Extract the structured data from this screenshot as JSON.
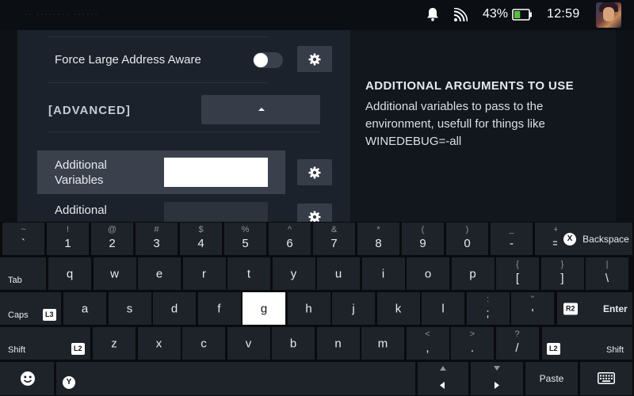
{
  "status": {
    "faint_title": "·· ········ ······",
    "battery_percent": "43%",
    "battery_level": 0.43,
    "time": "12:59",
    "icons": [
      "bell-icon",
      "cast-icon",
      "battery-icon",
      "avatar"
    ]
  },
  "settings": {
    "force_large_address_aware": "Force Large Address Aware",
    "force_large_address_aware_on": false,
    "advanced_header": "[ADVANCED]",
    "additional_variables": "Additional Variables",
    "additional_variables_value": "",
    "additional_arguments": "Additional",
    "gear_icon": "gear-icon"
  },
  "help": {
    "title": "ADDITIONAL ARGUMENTS TO USE",
    "body": "Additional variables to pass to the environment, usefull for things like WINEDEBUG=-all"
  },
  "keyboard": {
    "row1": [
      {
        "top": "~",
        "main": "`"
      },
      {
        "top": "!",
        "main": "1"
      },
      {
        "top": "@",
        "main": "2"
      },
      {
        "top": "#",
        "main": "3"
      },
      {
        "top": "$",
        "main": "4"
      },
      {
        "top": "%",
        "main": "5"
      },
      {
        "top": "^",
        "main": "6"
      },
      {
        "top": "&",
        "main": "7"
      },
      {
        "top": "*",
        "main": "8"
      },
      {
        "top": "(",
        "main": "9"
      },
      {
        "top": ")",
        "main": "0"
      },
      {
        "top": "_",
        "main": "-"
      },
      {
        "top": "+",
        "main": "="
      }
    ],
    "backspace": "Backspace",
    "backspace_badge": "X",
    "tab": "Tab",
    "row2": [
      {
        "top": "",
        "main": "q"
      },
      {
        "top": "",
        "main": "w"
      },
      {
        "top": "",
        "main": "e"
      },
      {
        "top": "",
        "main": "r"
      },
      {
        "top": "",
        "main": "t"
      },
      {
        "top": "",
        "main": "y"
      },
      {
        "top": "",
        "main": "u"
      },
      {
        "top": "",
        "main": "i"
      },
      {
        "top": "",
        "main": "o"
      },
      {
        "top": "",
        "main": "p"
      },
      {
        "top": "{",
        "main": "["
      },
      {
        "top": "}",
        "main": "]"
      },
      {
        "top": "|",
        "main": "\\"
      }
    ],
    "caps": "Caps",
    "caps_badge": "L3",
    "row3": [
      {
        "top": "",
        "main": "a"
      },
      {
        "top": "",
        "main": "s"
      },
      {
        "top": "",
        "main": "d"
      },
      {
        "top": "",
        "main": "f"
      },
      {
        "top": "",
        "main": "g"
      },
      {
        "top": "",
        "main": "h"
      },
      {
        "top": "",
        "main": "j"
      },
      {
        "top": "",
        "main": "k"
      },
      {
        "top": "",
        "main": "l"
      },
      {
        "top": ":",
        "main": ";"
      },
      {
        "top": "\"",
        "main": "'"
      }
    ],
    "selected_key": "g",
    "enter": "Enter",
    "enter_badge": "R2",
    "shift": "Shift",
    "shift_badge": "L2",
    "row4": [
      {
        "top": "",
        "main": "z"
      },
      {
        "top": "",
        "main": "x"
      },
      {
        "top": "",
        "main": "c"
      },
      {
        "top": "",
        "main": "v"
      },
      {
        "top": "",
        "main": "b"
      },
      {
        "top": "",
        "main": "n"
      },
      {
        "top": "",
        "main": "m"
      },
      {
        "top": "<",
        "main": ","
      },
      {
        "top": ">",
        "main": "."
      },
      {
        "top": "?",
        "main": "/"
      }
    ],
    "shift_right": "Shift",
    "shift_right_badge": "L2",
    "emoji_icon": "emoji-icon",
    "space_badge": "Y",
    "paste": "Paste",
    "keyboard_icon": "keyboard-icon"
  }
}
